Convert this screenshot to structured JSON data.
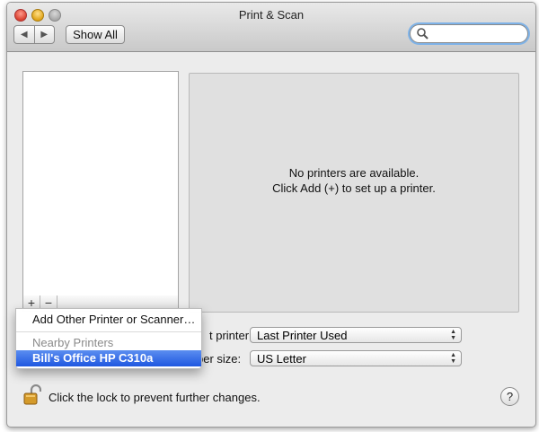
{
  "window": {
    "title": "Print & Scan"
  },
  "toolbar": {
    "back_glyph": "◀",
    "forward_glyph": "▶",
    "show_all_label": "Show All",
    "search_value": ""
  },
  "printers": {
    "add_glyph": "+",
    "remove_glyph": "−",
    "empty_line1": "No printers are available.",
    "empty_line2": "Click Add (+) to set up a printer."
  },
  "settings": {
    "default_printer_label_visible": "t printer:",
    "default_printer_value": "Last Printer Used",
    "paper_size_label_visible": "per size:",
    "paper_size_value": "US Letter"
  },
  "add_menu": {
    "add_other": "Add Other Printer or Scanner…",
    "nearby_header": "Nearby Printers",
    "nearby_items": [
      "Bill's Office HP C310a"
    ]
  },
  "footer": {
    "lock_text": "Click the lock to prevent further changes.",
    "help_glyph": "?"
  },
  "colors": {
    "selection": "#1f57e0",
    "search_focus": "#7fb3e8",
    "window_bg": "#ececec"
  },
  "icons": [
    "back-icon",
    "forward-icon",
    "search-icon",
    "lock-icon",
    "help-icon",
    "popup-arrows-icon"
  ]
}
